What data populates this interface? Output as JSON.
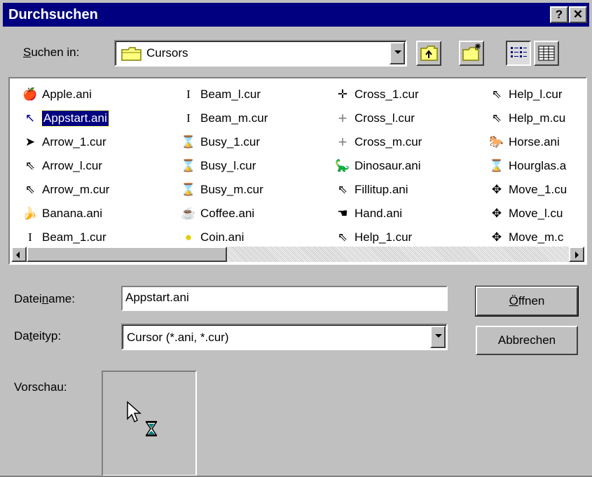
{
  "window": {
    "title": "Durchsuchen",
    "help_button": "?",
    "close_button": "✕"
  },
  "look_in": {
    "label_pre": "",
    "label_underline": "S",
    "label_post": "uchen in:",
    "value": "Cursors"
  },
  "files": {
    "columns": [
      [
        {
          "name": "Apple.ani",
          "icon": "🍎"
        },
        {
          "name": "Appstart.ani",
          "icon": "↖",
          "selected": true
        },
        {
          "name": "Arrow_1.cur",
          "icon": "➤"
        },
        {
          "name": "Arrow_l.cur",
          "icon": "⇖"
        },
        {
          "name": "Arrow_m.cur",
          "icon": "⇖"
        },
        {
          "name": "Banana.ani",
          "icon": "🍌"
        },
        {
          "name": "Beam_1.cur",
          "icon": "I"
        }
      ],
      [
        {
          "name": "Beam_l.cur",
          "icon": "I"
        },
        {
          "name": "Beam_m.cur",
          "icon": "I"
        },
        {
          "name": "Busy_1.cur",
          "icon": "⌛"
        },
        {
          "name": "Busy_l.cur",
          "icon": "⌛"
        },
        {
          "name": "Busy_m.cur",
          "icon": "⌛"
        },
        {
          "name": "Coffee.ani",
          "icon": "☕"
        },
        {
          "name": "Coin.ani",
          "icon": "●"
        }
      ],
      [
        {
          "name": "Cross_1.cur",
          "icon": "✛"
        },
        {
          "name": "Cross_l.cur",
          "icon": "+"
        },
        {
          "name": "Cross_m.cur",
          "icon": "+"
        },
        {
          "name": "Dinosaur.ani",
          "icon": "🦕"
        },
        {
          "name": "Fillitup.ani",
          "icon": "⇖"
        },
        {
          "name": "Hand.ani",
          "icon": "☚"
        },
        {
          "name": "Help_1.cur",
          "icon": "⇖"
        }
      ],
      [
        {
          "name": "Help_l.cur",
          "icon": "⇖"
        },
        {
          "name": "Help_m.cu",
          "icon": "⇖"
        },
        {
          "name": "Horse.ani",
          "icon": "🐎"
        },
        {
          "name": "Hourglas.a",
          "icon": "⌛"
        },
        {
          "name": "Move_1.cu",
          "icon": "✥"
        },
        {
          "name": "Move_l.cu",
          "icon": "✥"
        },
        {
          "name": "Move_m.c",
          "icon": "✥"
        }
      ]
    ]
  },
  "filename": {
    "label_pre": "Datei",
    "label_underline": "n",
    "label_post": "ame:",
    "value": "Appstart.ani"
  },
  "filetype": {
    "label_pre": "Da",
    "label_underline": "t",
    "label_post": "eityp:",
    "value": "Cursor (*.ani, *.cur)"
  },
  "buttons": {
    "open_pre": "",
    "open_underline": "Ö",
    "open_post": "ffnen",
    "cancel": "Abbrechen"
  },
  "preview": {
    "label": "Vorschau:"
  },
  "colors": {
    "titlebar": "#000080",
    "face": "#c0c0c0",
    "selection": "#000080"
  }
}
